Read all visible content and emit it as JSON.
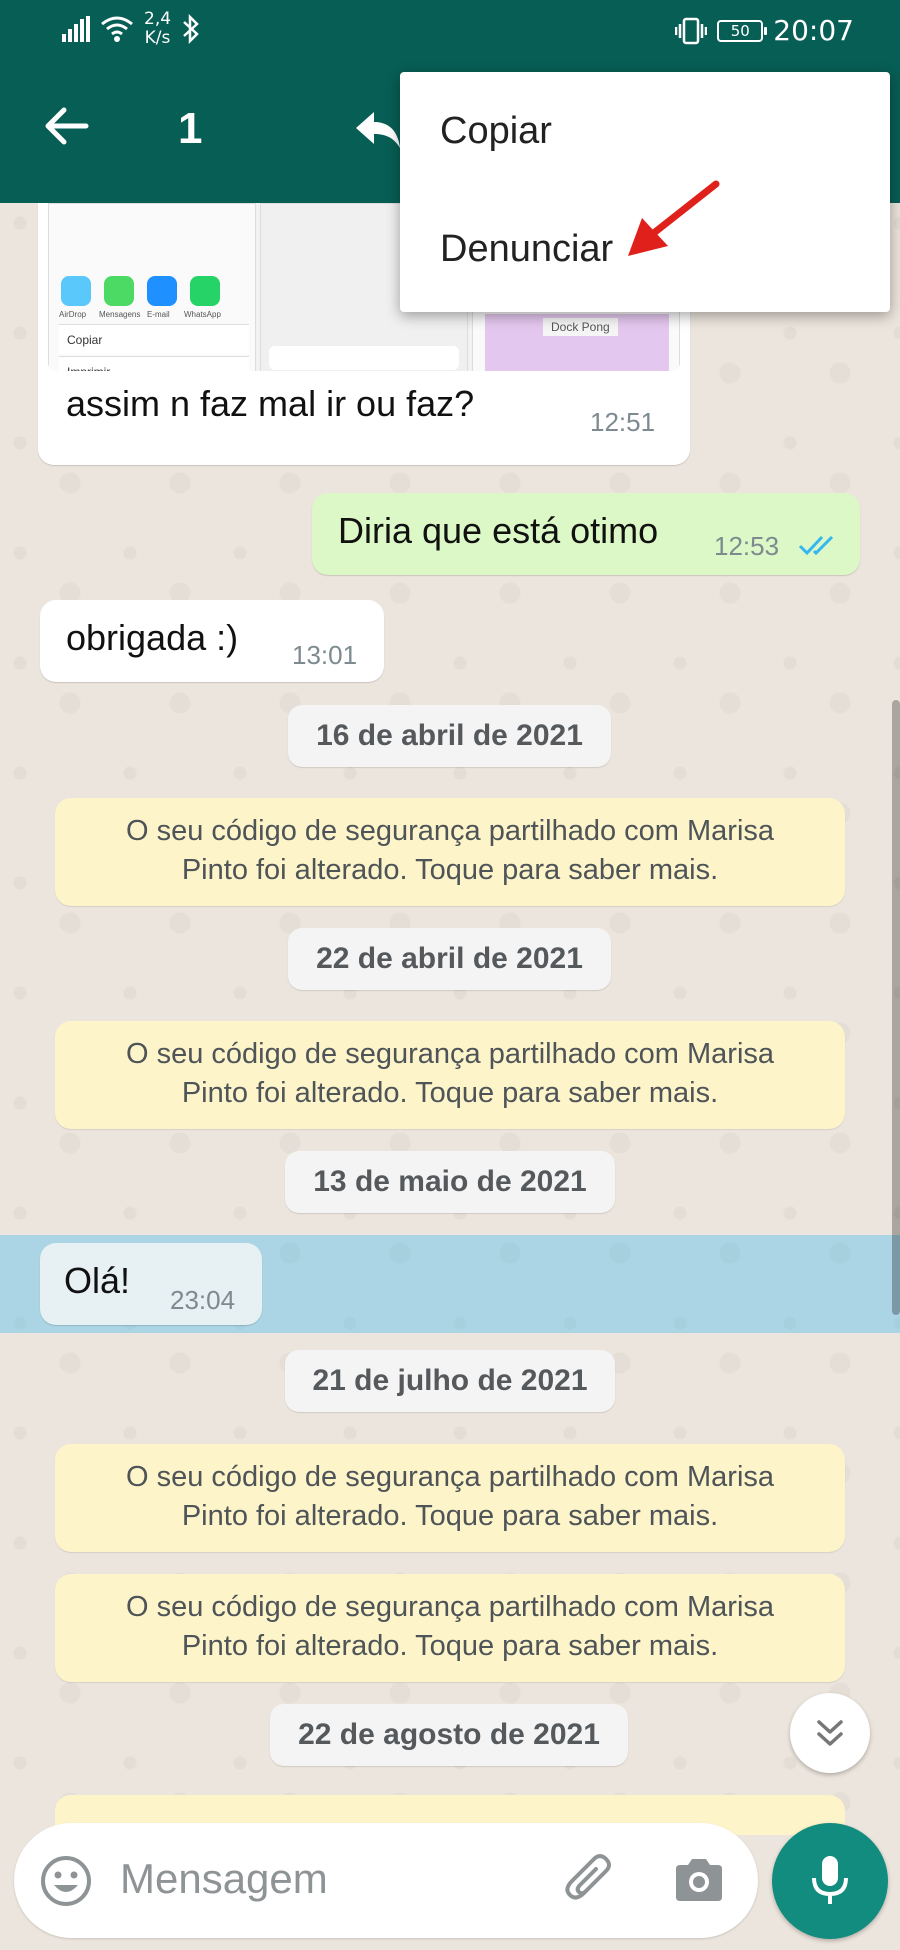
{
  "status_bar": {
    "speed_value": "2,4",
    "speed_unit": "K/s",
    "battery": "50",
    "time": "20:07"
  },
  "toolbar": {
    "selected_count": "1"
  },
  "menu": {
    "items": [
      {
        "label": "Copiar"
      },
      {
        "label": "Denunciar"
      }
    ]
  },
  "messages": {
    "m1": {
      "text": "assim n faz mal ir ou faz?",
      "time": "12:51"
    },
    "m2": {
      "text": "Diria que está otimo",
      "time": "12:53"
    },
    "m3": {
      "text": "obrigada :)",
      "time": "13:01"
    },
    "m4": {
      "text": "Olá!",
      "time": "23:04"
    }
  },
  "dates": {
    "d1": "16 de abril de 2021",
    "d2": "22 de abril de 2021",
    "d3": "13 de maio de 2021",
    "d4": "21 de julho de 2021",
    "d5": "22 de agosto de 2021"
  },
  "system_notice": {
    "line1": "O seu código de segurança partilhado com Marisa",
    "line2": "Pinto foi alterado. Toque para saber mais."
  },
  "screenshot_preview": {
    "copy_label": "Copiar",
    "print_label": "Imprimir",
    "dock_label": "Dock Pong",
    "app_labels": [
      "AirDrop",
      "Mensagens",
      "E-mail",
      "WhatsApp"
    ]
  },
  "input": {
    "placeholder": "Mensagem"
  },
  "colors": {
    "header": "#075e54",
    "outgoing_bubble": "#dcf8c6",
    "system_notice": "#fdf4c9",
    "mic_button": "#128c7e",
    "read_ticks": "#34b7f1",
    "annotation_arrow": "#e0201b"
  }
}
